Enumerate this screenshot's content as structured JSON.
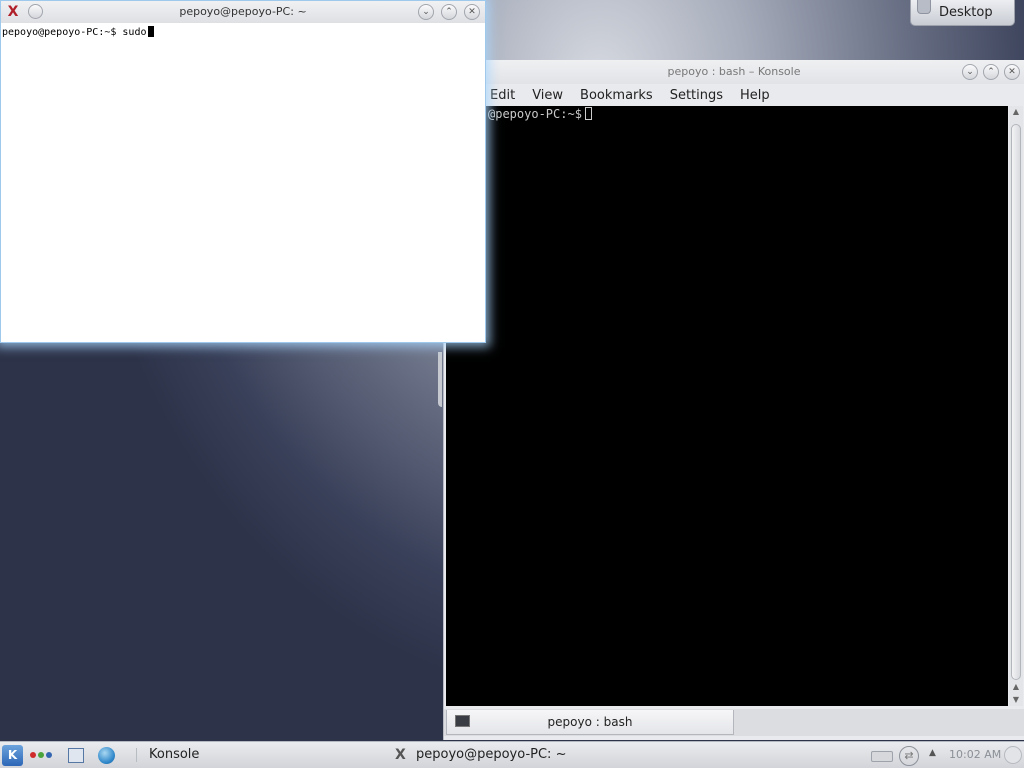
{
  "pager": {
    "label": "Desktop",
    "icon": "desktop-pager-icon"
  },
  "konsole": {
    "title": "pepoyo : bash – Konsole",
    "menu": [
      "Edit",
      "View",
      "Bookmarks",
      "Settings",
      "Help"
    ],
    "prompt": "@pepoyo-PC:~$",
    "tab_label": "pepoyo : bash"
  },
  "xterm": {
    "title": "pepoyo@pepoyo-PC: ~",
    "prompt": "pepoyo@pepoyo-PC:~$ sudo"
  },
  "taskbar": {
    "kmenu_icon": "K",
    "task_konsole": "Konsole",
    "task_xterm": "pepoyo@pepoyo-PC: ~",
    "clock": "10:02 AM",
    "dot_colors": [
      "#d02b2b",
      "#4aa33b",
      "#3465b0"
    ]
  }
}
